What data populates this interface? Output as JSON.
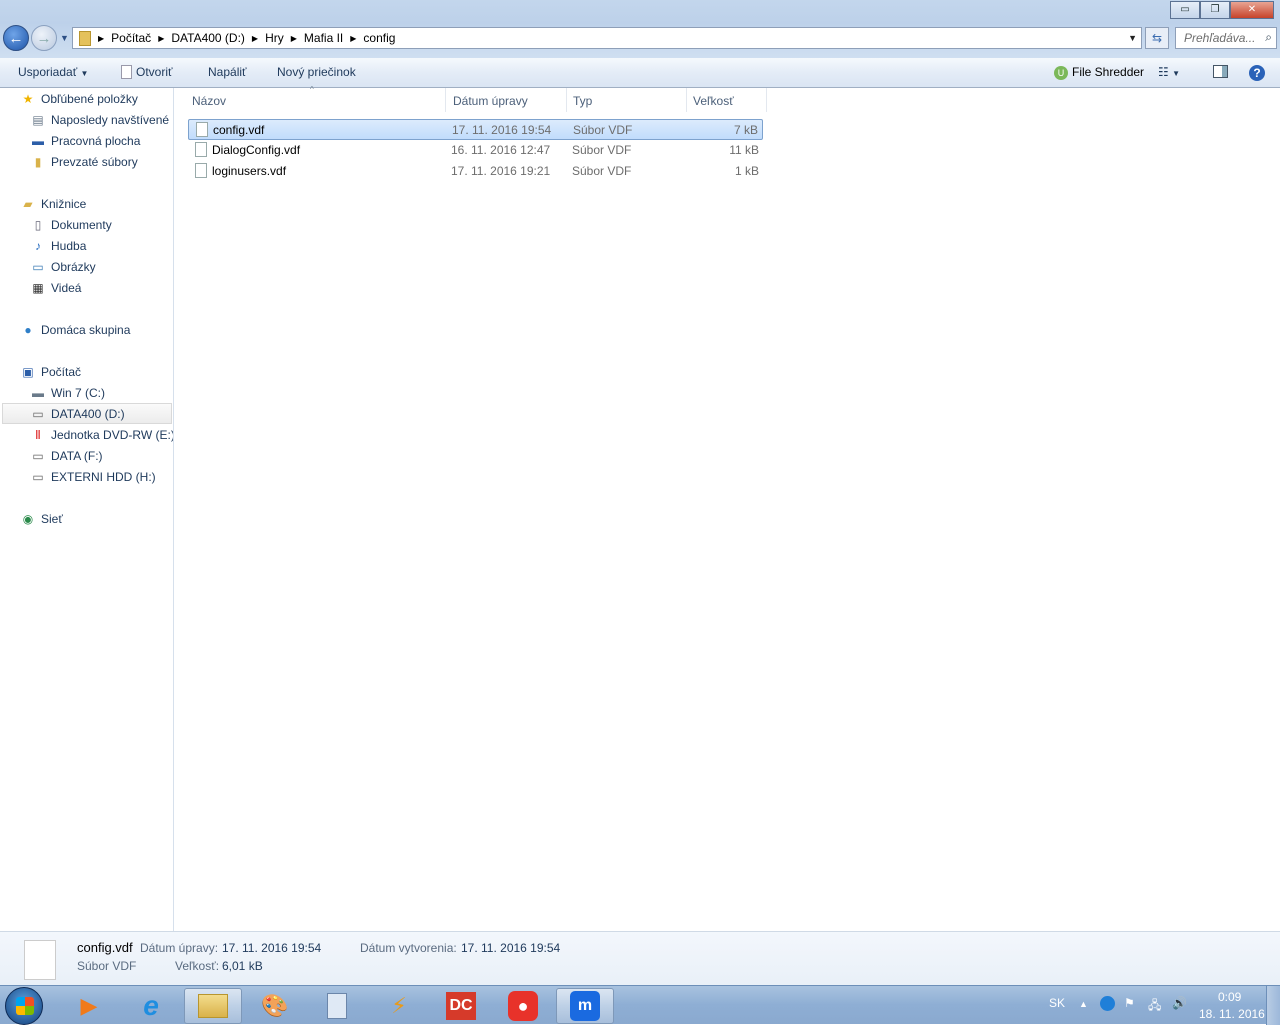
{
  "window": {
    "minimize": "▭",
    "maximize": "❐",
    "close": "✕"
  },
  "address": {
    "path": [
      "Počítač",
      "DATA400 (D:)",
      "Hry",
      "Mafia II",
      "config"
    ],
    "search_placeholder": "Prehľadáva..."
  },
  "toolbar": {
    "organize": "Usporiadať",
    "open": "Otvoriť",
    "burn": "Napáliť",
    "new_folder": "Nový priečinok",
    "file_shredder": "File Shredder"
  },
  "sidebar": [
    {
      "label": "Obľúbené položky",
      "icon": "star-icon",
      "glyph": "★",
      "color": "#f0b400",
      "level": 0
    },
    {
      "label": "Naposledy navštívené miesta",
      "icon": "recent-places-icon",
      "glyph": "▤",
      "color": "#6a7a8a",
      "level": 1
    },
    {
      "label": "Pracovná plocha",
      "icon": "desktop-icon",
      "glyph": "▬",
      "color": "#2c5ea8",
      "level": 1
    },
    {
      "label": "Prevzaté súbory",
      "icon": "downloads-folder-icon",
      "glyph": "▮",
      "color": "#d9b24a",
      "level": 1
    },
    {
      "gap": true
    },
    {
      "label": "Knižnice",
      "icon": "libraries-icon",
      "glyph": "▰",
      "color": "#d9b24a",
      "level": 0
    },
    {
      "label": "Dokumenty",
      "icon": "documents-icon",
      "glyph": "▯",
      "color": "#667",
      "level": 1
    },
    {
      "label": "Hudba",
      "icon": "music-icon",
      "glyph": "♪",
      "color": "#2a6fc2",
      "level": 1
    },
    {
      "label": "Obrázky",
      "icon": "pictures-icon",
      "glyph": "▭",
      "color": "#3b7bb4",
      "level": 1
    },
    {
      "label": "Videá",
      "icon": "videos-icon",
      "glyph": "▦",
      "color": "#333",
      "level": 1
    },
    {
      "gap": true
    },
    {
      "label": "Domáca skupina",
      "icon": "homegroup-icon",
      "glyph": "●",
      "color": "#2f7fc8",
      "level": 0
    },
    {
      "gap": true
    },
    {
      "label": "Počítač",
      "icon": "computer-icon",
      "glyph": "▣",
      "color": "#2c5ea8",
      "level": 0
    },
    {
      "label": "Win 7 (C:)",
      "icon": "system-drive-icon",
      "glyph": "▬",
      "color": "#6a7a8a",
      "level": 1
    },
    {
      "label": "DATA400 (D:)",
      "icon": "drive-icon",
      "glyph": "▭",
      "color": "#666",
      "level": 1,
      "selected": true
    },
    {
      "label": "Jednotka DVD-RW (E:) I",
      "icon": "dvd-drive-icon",
      "glyph": "Ⅱ",
      "color": "#d22",
      "level": 1
    },
    {
      "label": "DATA (F:)",
      "icon": "drive-icon",
      "glyph": "▭",
      "color": "#666",
      "level": 1
    },
    {
      "label": "EXTERNI HDD (H:)",
      "icon": "drive-icon",
      "glyph": "▭",
      "color": "#666",
      "level": 1
    },
    {
      "gap": true
    },
    {
      "label": "Sieť",
      "icon": "network-icon",
      "glyph": "◉",
      "color": "#2a8a4a",
      "level": 0
    }
  ],
  "columns": {
    "name": "Názov",
    "modified": "Dátum úpravy",
    "type": "Typ",
    "size": "Veľkosť"
  },
  "files": [
    {
      "name": "config.vdf",
      "modified": "17. 11. 2016 19:54",
      "type": "Súbor VDF",
      "size": "7 kB",
      "selected": true
    },
    {
      "name": "DialogConfig.vdf",
      "modified": "16. 11. 2016 12:47",
      "type": "Súbor VDF",
      "size": "11 kB"
    },
    {
      "name": "loginusers.vdf",
      "modified": "17. 11. 2016 19:21",
      "type": "Súbor VDF",
      "size": "1 kB"
    }
  ],
  "details": {
    "name": "config.vdf",
    "modified_label": "Dátum úpravy:",
    "modified": "17. 11. 2016 19:54",
    "created_label": "Dátum vytvorenia:",
    "created": "17. 11. 2016 19:54",
    "type": "Súbor VDF",
    "size_label": "Veľkosť:",
    "size": "6,01 kB"
  },
  "tray": {
    "lang": "SK",
    "time": "0:09",
    "date": "18. 11. 2016"
  }
}
